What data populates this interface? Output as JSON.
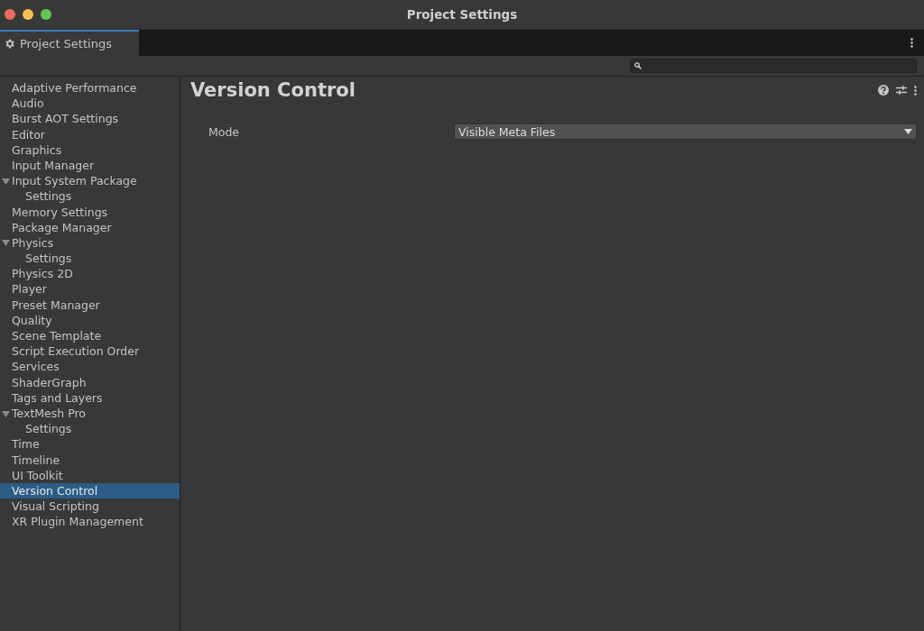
{
  "window": {
    "title": "Project Settings"
  },
  "tab": {
    "label": "Project Settings",
    "selected": true
  },
  "sidebar": {
    "items": [
      {
        "label": "Adaptive Performance",
        "selected": false
      },
      {
        "label": "Audio",
        "selected": false
      },
      {
        "label": "Burst AOT Settings",
        "selected": false
      },
      {
        "label": "Editor",
        "selected": false
      },
      {
        "label": "Graphics",
        "selected": false
      },
      {
        "label": "Input Manager",
        "selected": false
      },
      {
        "label": "Input System Package",
        "selected": false,
        "expanded": true,
        "children": [
          {
            "label": "Settings",
            "selected": false
          }
        ]
      },
      {
        "label": "Memory Settings",
        "selected": false
      },
      {
        "label": "Package Manager",
        "selected": false
      },
      {
        "label": "Physics",
        "selected": false,
        "expanded": true,
        "children": [
          {
            "label": "Settings",
            "selected": false
          }
        ]
      },
      {
        "label": "Physics 2D",
        "selected": false
      },
      {
        "label": "Player",
        "selected": false
      },
      {
        "label": "Preset Manager",
        "selected": false
      },
      {
        "label": "Quality",
        "selected": false
      },
      {
        "label": "Scene Template",
        "selected": false
      },
      {
        "label": "Script Execution Order",
        "selected": false
      },
      {
        "label": "Services",
        "selected": false
      },
      {
        "label": "ShaderGraph",
        "selected": false
      },
      {
        "label": "Tags and Layers",
        "selected": false
      },
      {
        "label": "TextMesh Pro",
        "selected": false,
        "expanded": true,
        "children": [
          {
            "label": "Settings",
            "selected": false
          }
        ]
      },
      {
        "label": "Time",
        "selected": false
      },
      {
        "label": "Timeline",
        "selected": false
      },
      {
        "label": "UI Toolkit",
        "selected": false
      },
      {
        "label": "Version Control",
        "selected": true
      },
      {
        "label": "Visual Scripting",
        "selected": false
      },
      {
        "label": "XR Plugin Management",
        "selected": false
      }
    ]
  },
  "panel": {
    "title": "Version Control",
    "fields": [
      {
        "label": "Mode",
        "value": "Visible Meta Files"
      }
    ]
  }
}
